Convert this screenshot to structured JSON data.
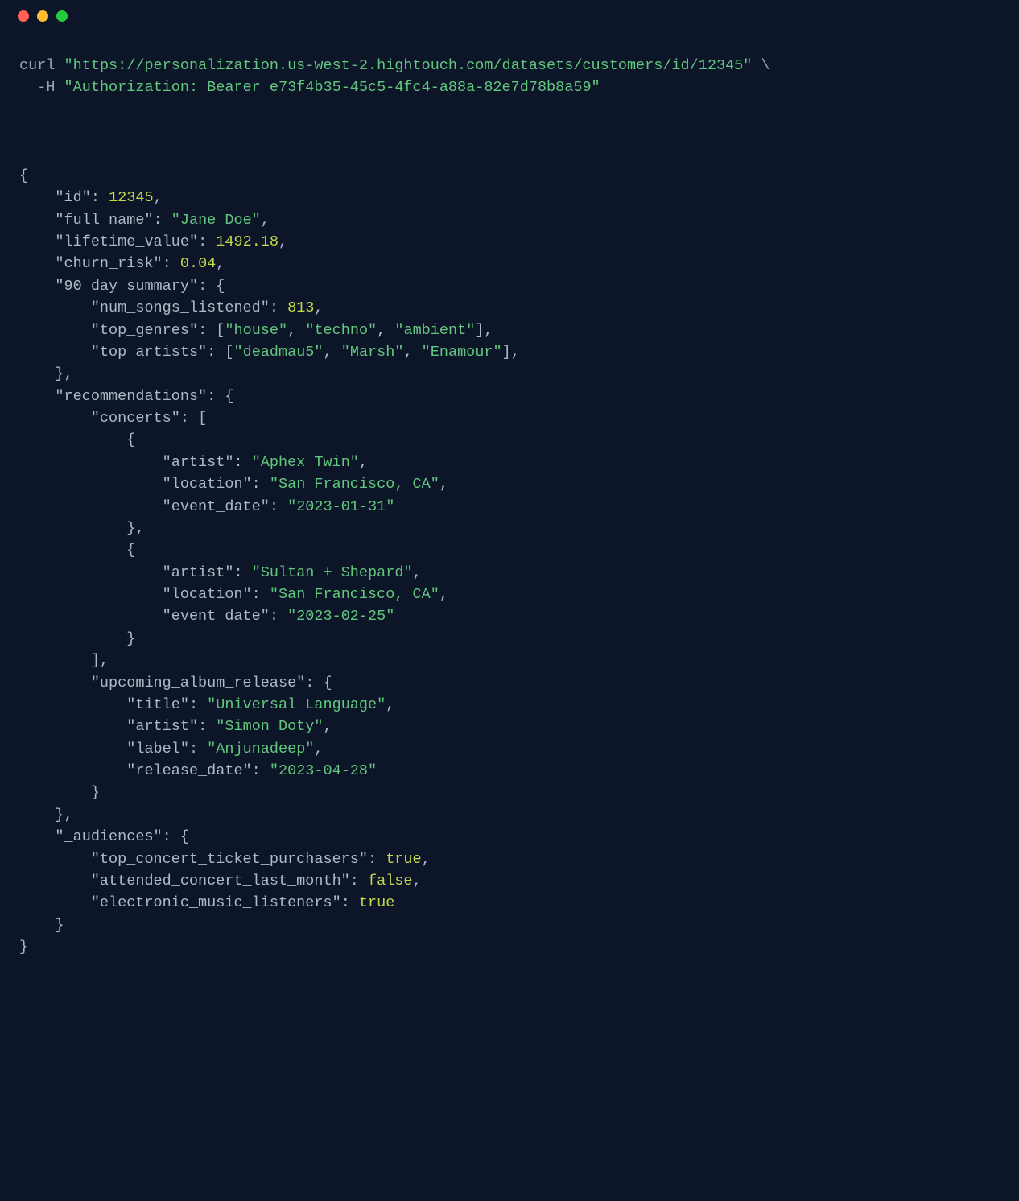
{
  "window": {
    "traffic_lights": [
      "red",
      "amber",
      "green"
    ]
  },
  "command": {
    "cmd": "curl",
    "url": "\"https://personalization.us-west-2.hightouch.com/datasets/customers/id/12345\"",
    "continuation": "\\",
    "flag": "-H",
    "header": "\"Authorization: Bearer e73f4b35-45c5-4fc4-a88a-82e7d78b8a59\""
  },
  "json": {
    "id_key": "\"id\"",
    "id_val": "12345",
    "full_name_key": "\"full_name\"",
    "full_name_val": "\"Jane Doe\"",
    "ltv_key": "\"lifetime_value\"",
    "ltv_val": "1492.18",
    "churn_key": "\"churn_risk\"",
    "churn_val": "0.04",
    "summary_key": "\"90_day_summary\"",
    "num_songs_key": "\"num_songs_listened\"",
    "num_songs_val": "813",
    "top_genres_key": "\"top_genres\"",
    "genre1": "\"house\"",
    "genre2": "\"techno\"",
    "genre3": "\"ambient\"",
    "top_artists_key": "\"top_artists\"",
    "artist1": "\"deadmau5\"",
    "artist2": "\"Marsh\"",
    "artist3": "\"Enamour\"",
    "recs_key": "\"recommendations\"",
    "concerts_key": "\"concerts\"",
    "c1_artist_key": "\"artist\"",
    "c1_artist_val": "\"Aphex Twin\"",
    "c1_loc_key": "\"location\"",
    "c1_loc_val": "\"San Francisco, CA\"",
    "c1_date_key": "\"event_date\"",
    "c1_date_val": "\"2023-01-31\"",
    "c2_artist_key": "\"artist\"",
    "c2_artist_val": "\"Sultan + Shepard\"",
    "c2_loc_key": "\"location\"",
    "c2_loc_val": "\"San Francisco, CA\"",
    "c2_date_key": "\"event_date\"",
    "c2_date_val": "\"2023-02-25\"",
    "album_key": "\"upcoming_album_release\"",
    "al_title_key": "\"title\"",
    "al_title_val": "\"Universal Language\"",
    "al_artist_key": "\"artist\"",
    "al_artist_val": "\"Simon Doty\"",
    "al_label_key": "\"label\"",
    "al_label_val": "\"Anjunadeep\"",
    "al_date_key": "\"release_date\"",
    "al_date_val": "\"2023-04-28\"",
    "aud_key": "\"_audiences\"",
    "aud1_key": "\"top_concert_ticket_purchasers\"",
    "aud1_val": "true",
    "aud2_key": "\"attended_concert_last_month\"",
    "aud2_val": "false",
    "aud3_key": "\"electronic_music_listeners\"",
    "aud3_val": "true"
  },
  "p": {
    "ob": "{",
    "cb": "}",
    "obT": "{",
    "cbT": "}",
    "osb": "[",
    "csb": "]",
    "colon": ":",
    "comma": ",",
    "comma_sp": ", ",
    "cb_comma": "},",
    "csb_comma": "],"
  }
}
